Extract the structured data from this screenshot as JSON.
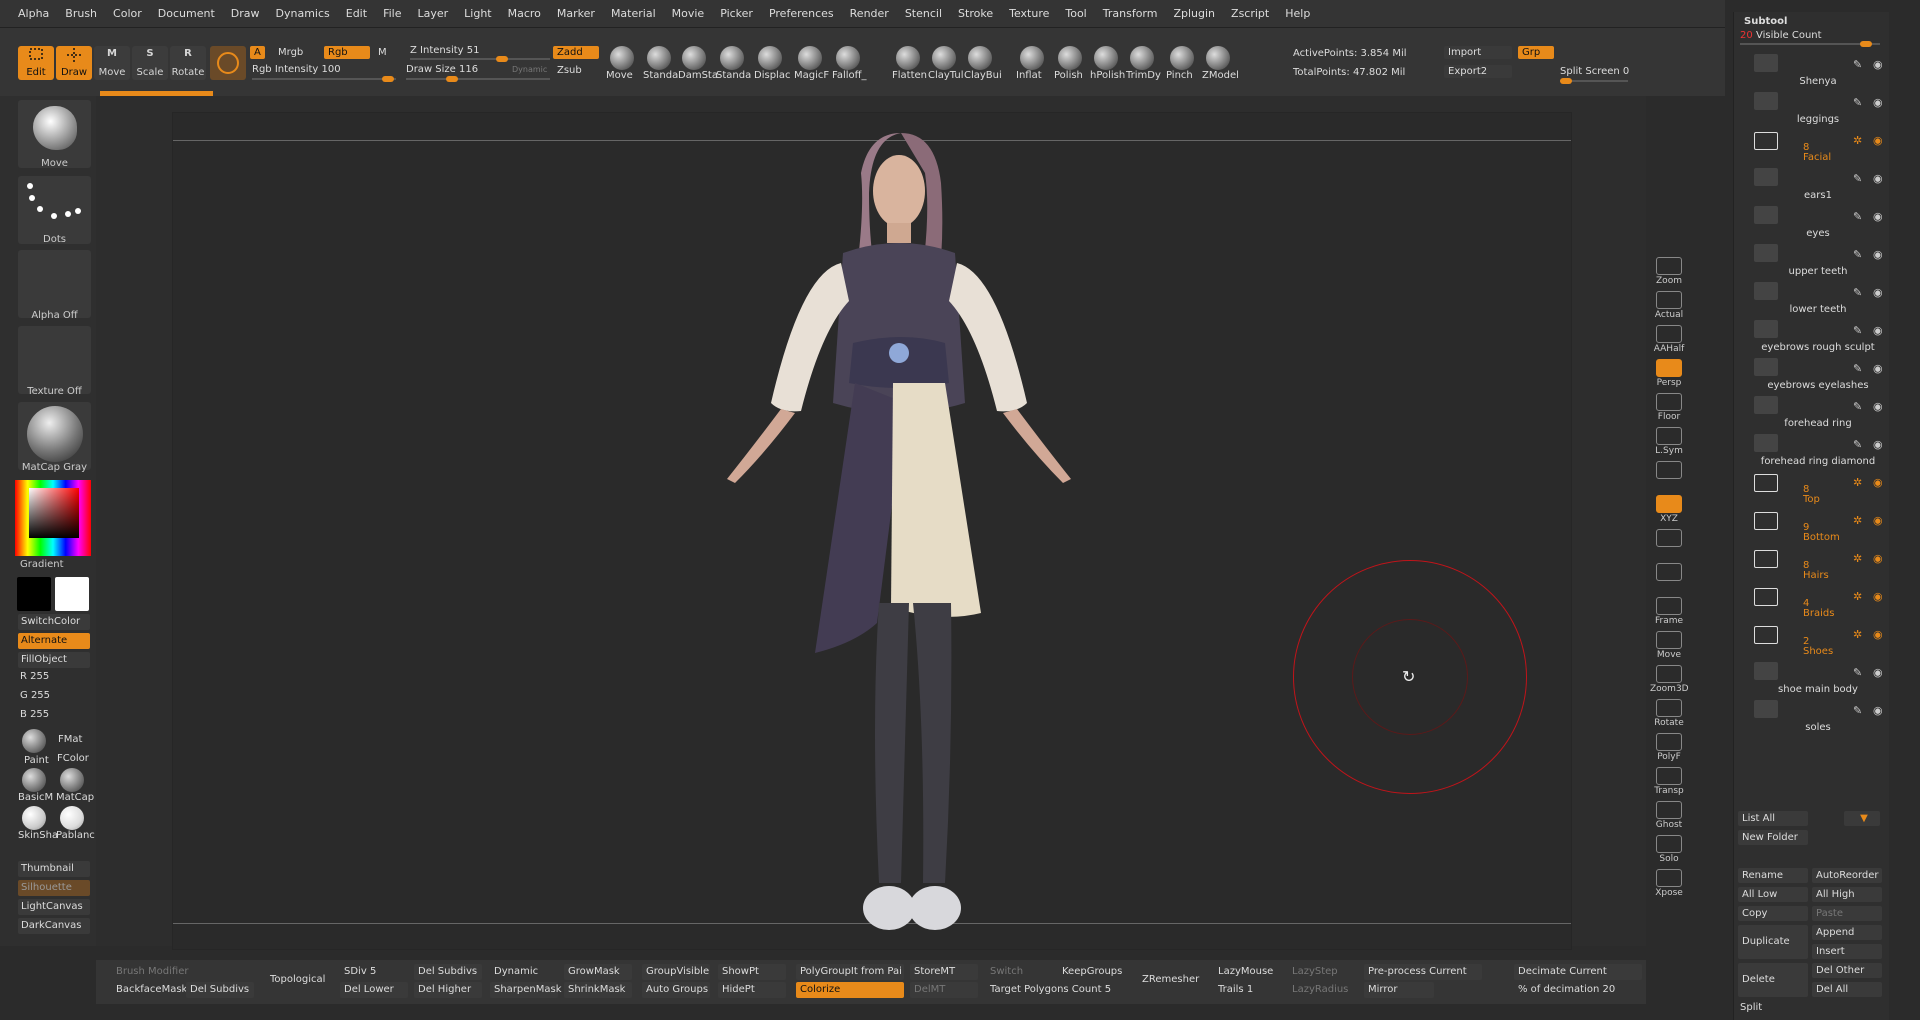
{
  "menu": [
    "Alpha",
    "Brush",
    "Color",
    "Document",
    "Draw",
    "Dynamics",
    "Edit",
    "File",
    "Layer",
    "Light",
    "Macro",
    "Marker",
    "Material",
    "Movie",
    "Picker",
    "Preferences",
    "Render",
    "Stencil",
    "Stroke",
    "Texture",
    "Tool",
    "Transform",
    "Zplugin",
    "Zscript",
    "Help"
  ],
  "toolbar": {
    "edit": "Edit",
    "draw": "Draw",
    "move": "Move",
    "scale": "Scale",
    "rotate": "Rotate",
    "a": "A",
    "mrgb": "Mrgb",
    "rgb": "Rgb",
    "m": "M",
    "rgb_intensity_label": "Rgb Intensity",
    "rgb_intensity": "100",
    "z_intensity_label": "Z Intensity",
    "z_intensity": "51",
    "draw_size_label": "Draw Size",
    "draw_size": "116",
    "dynamic": "Dynamic",
    "zadd": "Zadd",
    "zsub": "Zsub",
    "brushes": [
      "Move",
      "Standa",
      "DamSta",
      "Standa",
      "Displac",
      "MagicF",
      "Falloff_",
      "Flatten",
      "ClayTul",
      "ClayBui",
      "Inflat",
      "Polish",
      "hPolish",
      "TrimDy",
      "Pinch",
      "ZModel"
    ],
    "active_points": "ActivePoints: 3.854 Mil",
    "total_points": "TotalPoints: 47.802 Mil",
    "import": "Import",
    "grp": "Grp",
    "export": "Export2",
    "split_screen_label": "Split Screen",
    "split_screen": "0"
  },
  "left": {
    "brush": "Move",
    "stroke": "Dots",
    "alpha": "Alpha Off",
    "texture": "Texture Off",
    "material": "MatCap Gray",
    "gradient": "Gradient",
    "switchcolor": "SwitchColor",
    "alternate": "Alternate",
    "fillobject": "FillObject",
    "r_label": "R",
    "r": "255",
    "g_label": "G",
    "g": "255",
    "b_label": "B",
    "b": "255",
    "paint": "Paint",
    "fmat": "FMat",
    "fcolor": "FColor",
    "basicm": "BasicM",
    "matcap": "MatCap",
    "skinsha": "SkinSha",
    "pablan": "Pablanc",
    "thumbnail": "Thumbnail",
    "silhouette": "Silhouette",
    "lightcanvas": "LightCanvas",
    "darkcanvas": "DarkCanvas",
    "main_color": "#ffffff"
  },
  "rightbar": [
    "Zoom",
    "Actual",
    "AAHalf",
    "Persp",
    "Floor",
    "L.Sym",
    "",
    "XYZ",
    "",
    "",
    "Frame",
    "Move",
    "Zoom3D",
    "Rotate",
    "PolyF",
    "Transp",
    "Ghost",
    "Solo",
    "Xpose"
  ],
  "subtool": {
    "title": "Subtool",
    "visible_count_label": "Visible Count",
    "visible_count": "20",
    "items": [
      {
        "name": "Shenya",
        "folder": false
      },
      {
        "name": "leggings",
        "folder": false
      },
      {
        "name": "Facial",
        "folder": true,
        "count": "8"
      },
      {
        "name": "ears1",
        "folder": false
      },
      {
        "name": "eyes",
        "folder": false
      },
      {
        "name": "upper teeth",
        "folder": false
      },
      {
        "name": "lower teeth",
        "folder": false
      },
      {
        "name": "eyebrows rough sculpt",
        "folder": false
      },
      {
        "name": "eyebrows eyelashes",
        "folder": false
      },
      {
        "name": "forehead ring",
        "folder": false
      },
      {
        "name": "forehead ring diamond",
        "folder": false
      },
      {
        "name": "Top",
        "folder": true,
        "count": "8"
      },
      {
        "name": "Bottom",
        "folder": true,
        "count": "9"
      },
      {
        "name": "Hairs",
        "folder": true,
        "count": "8"
      },
      {
        "name": "Braids",
        "folder": true,
        "count": "4"
      },
      {
        "name": "Shoes",
        "folder": true,
        "count": "2"
      },
      {
        "name": "shoe main body",
        "folder": false
      },
      {
        "name": "soles",
        "folder": false
      }
    ],
    "list_all": "List All",
    "new_folder": "New Folder",
    "rename": "Rename",
    "autoreorder": "AutoReorder",
    "all_low": "All Low",
    "all_high": "All High",
    "copy": "Copy",
    "paste": "Paste",
    "duplicate": "Duplicate",
    "append": "Append",
    "insert": "Insert",
    "delete": "Delete",
    "del_other": "Del Other",
    "del_all": "Del All",
    "split": "Split"
  },
  "bottom": {
    "brush_modifier": "Brush Modifier",
    "backface": "BackfaceMask",
    "del_subdivs_l": "Del Subdivs",
    "topological": "Topological",
    "sdiv_label": "SDiv",
    "sdiv": "5",
    "del_lower": "Del Lower",
    "del_subdivs": "Del Subdivs",
    "del_higher": "Del Higher",
    "dynamic": "Dynamic",
    "sharpenmask": "SharpenMask",
    "growmask": "GrowMask",
    "shrinkmask": "ShrinkMask",
    "groupvisible": "GroupVisible",
    "autogroups": "Auto Groups",
    "showpt": "ShowPt",
    "hidept": "HidePt",
    "polygroupit": "PolyGroupIt from Pai",
    "colorize": "Colorize",
    "storemt": "StoreMT",
    "delmt": "DelMT",
    "switch": "Switch",
    "keepgroups": "KeepGroups",
    "target_label": "Target Polygons Count",
    "target": "5",
    "zremesher": "ZRemesher",
    "lazymouse": "LazyMouse",
    "lazystep": "LazyStep",
    "trails_label": "Trails",
    "trails": "1",
    "lazyradius": "LazyRadius",
    "preprocess": "Pre-process Current",
    "mirror": "Mirror",
    "decimate": "Decimate Current",
    "pct_label": "% of decimation",
    "pct": "20"
  }
}
